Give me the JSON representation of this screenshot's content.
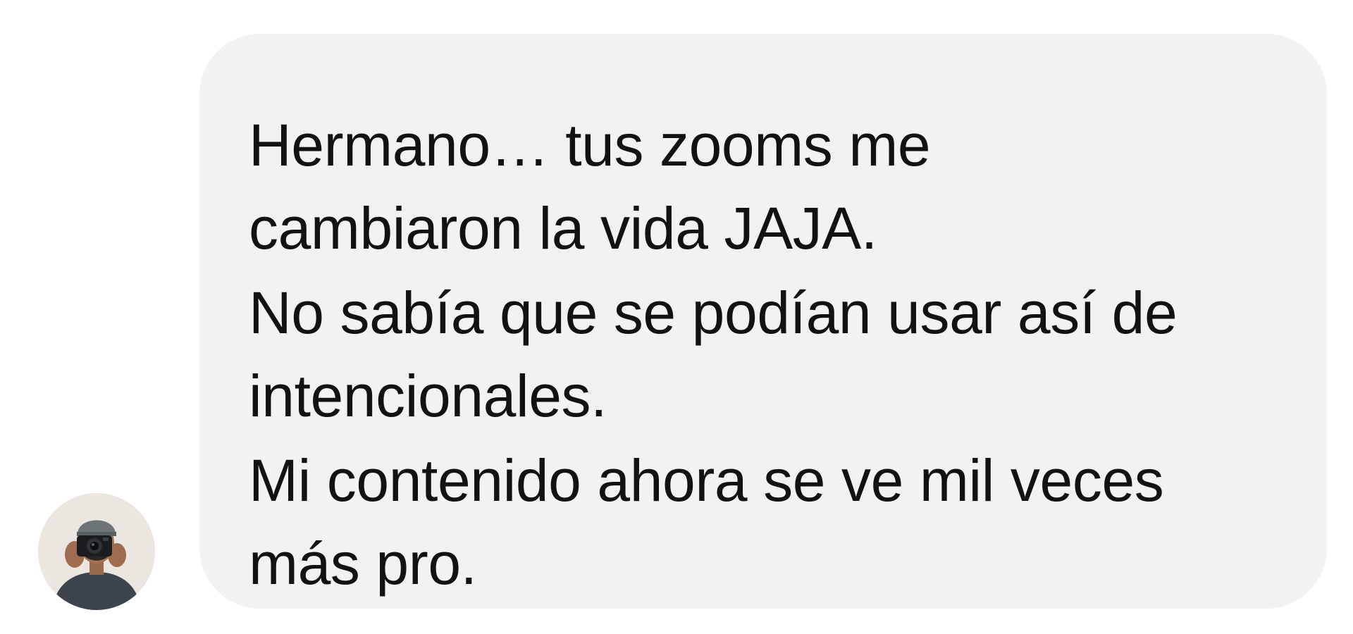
{
  "conversation": {
    "sender": {
      "avatar_icon": "photographer-with-camera-avatar"
    },
    "message": {
      "paragraphs": [
        "Hermano… tus zooms me\ncambiaron la vida JAJA.",
        "No sabía que se podían usar así de\nintencionales.",
        "Mi contenido ahora se ve mil veces\nmás pro."
      ]
    },
    "colors": {
      "bubble_background": "#f1f2f4",
      "text": "#121212",
      "page_background": "#ffffff"
    }
  }
}
